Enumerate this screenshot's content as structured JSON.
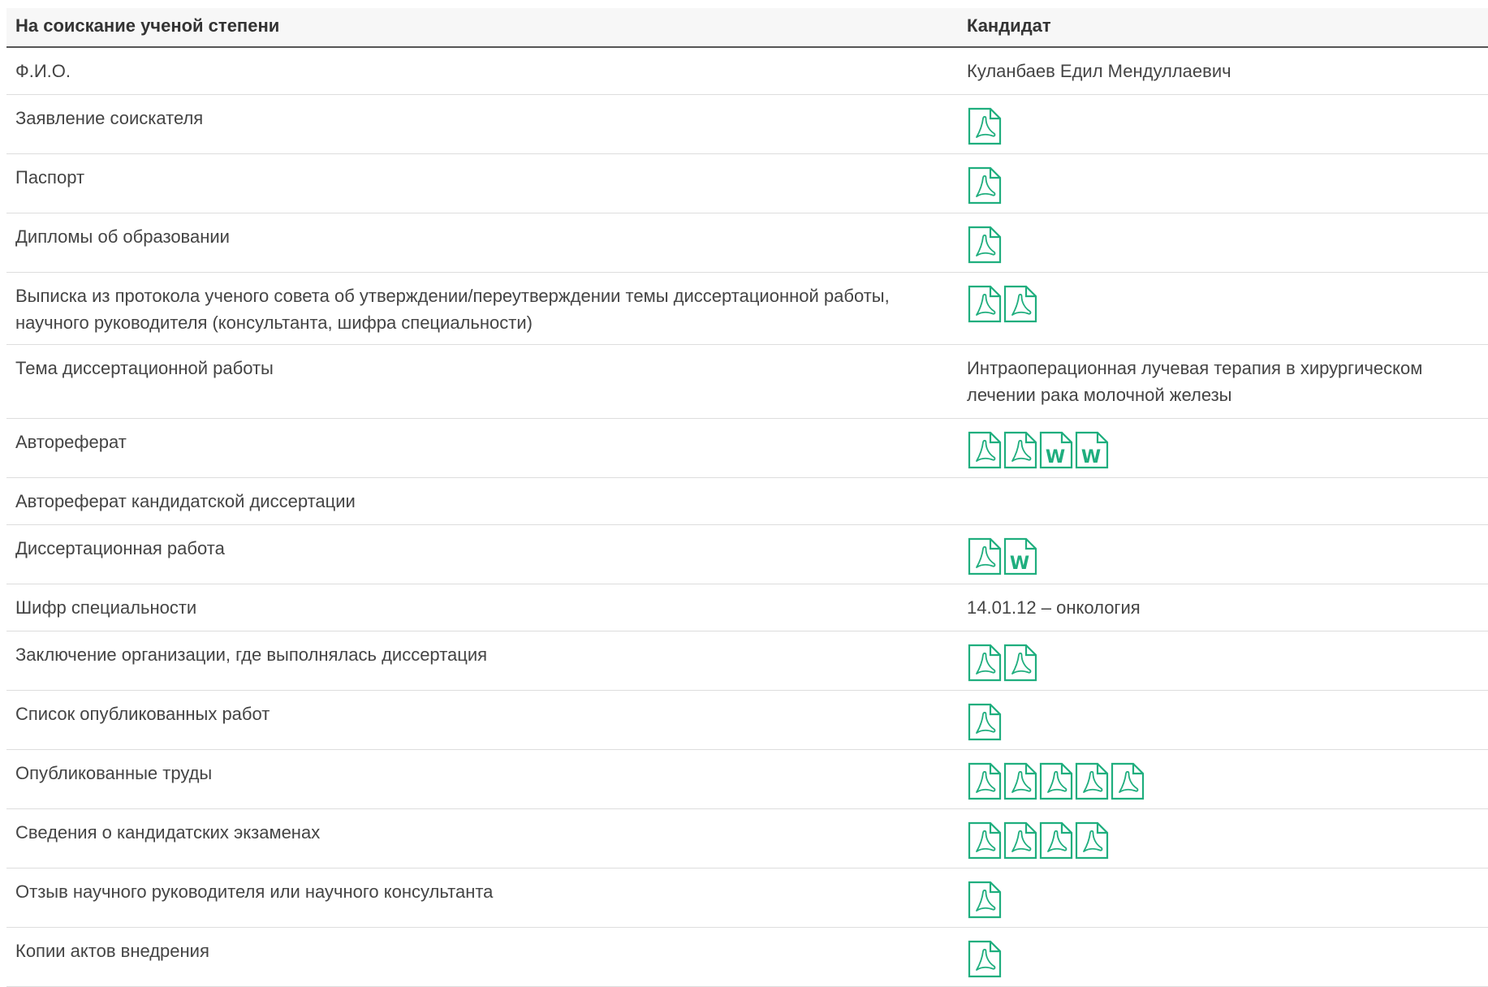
{
  "colors": {
    "accent": "#1fae7e",
    "text": "#444444",
    "border": "#dddddd"
  },
  "table": {
    "headers": [
      "На соискание ученой степени",
      "Кандидат"
    ],
    "rows": [
      {
        "label": "Ф.И.О.",
        "value": "Куланбаев Едил Мендуллаевич",
        "files": []
      },
      {
        "label": "Заявление соискателя",
        "value": "",
        "files": [
          "pdf"
        ]
      },
      {
        "label": "Паспорт",
        "value": "",
        "files": [
          "pdf"
        ]
      },
      {
        "label": "Дипломы об образовании",
        "value": "",
        "files": [
          "pdf"
        ]
      },
      {
        "label": "Выписка из протокола ученого совета об утверждении/переутверждении темы диссертационной работы, научного руководителя (консультанта, шифра специальности)",
        "value": "",
        "files": [
          "pdf",
          "pdf"
        ]
      },
      {
        "label": "Тема диссертационной работы",
        "value": "Интраоперационная лучевая терапия в хирургическом лечении рака молочной железы",
        "files": []
      },
      {
        "label": "Автореферат",
        "value": "",
        "files": [
          "pdf",
          "pdf",
          "word",
          "word"
        ]
      },
      {
        "label": "Автореферат кандидатской диссертации",
        "value": "",
        "files": []
      },
      {
        "label": "Диссертационная работа",
        "value": "",
        "files": [
          "pdf",
          "word"
        ]
      },
      {
        "label": "Шифр специальности",
        "value": "14.01.12 – онкология",
        "files": []
      },
      {
        "label": "Заключение организации, где выполнялась диссертация",
        "value": "",
        "files": [
          "pdf",
          "pdf"
        ]
      },
      {
        "label": "Список опубликованных работ",
        "value": "",
        "files": [
          "pdf"
        ]
      },
      {
        "label": "Опубликованные труды",
        "value": "",
        "files": [
          "pdf",
          "pdf",
          "pdf",
          "pdf",
          "pdf"
        ]
      },
      {
        "label": "Сведения о кандидатских экзаменах",
        "value": "",
        "files": [
          "pdf",
          "pdf",
          "pdf",
          "pdf"
        ]
      },
      {
        "label": "Отзыв научного руководителя или научного консультанта",
        "value": "",
        "files": [
          "pdf"
        ]
      },
      {
        "label": "Копии актов внедрения",
        "value": "",
        "files": [
          "pdf"
        ]
      }
    ]
  }
}
